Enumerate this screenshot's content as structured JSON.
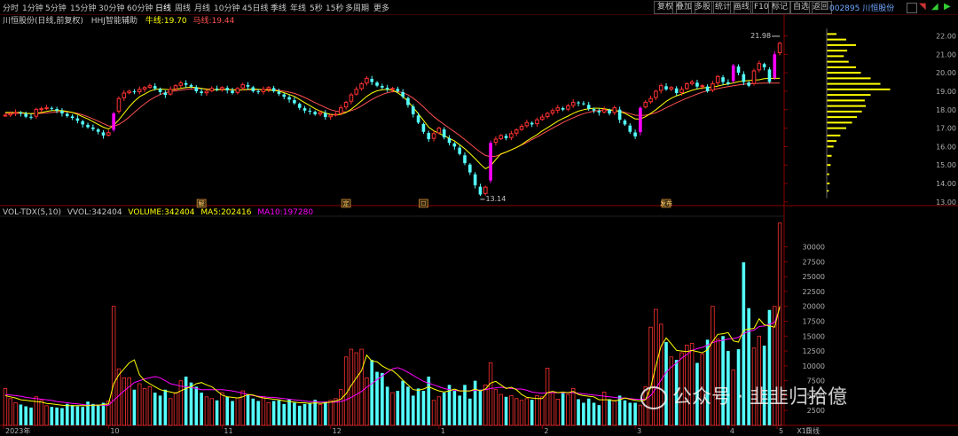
{
  "toolbar": {
    "items": [
      "分时",
      "1分钟",
      "5分钟",
      "15分钟",
      "30分钟",
      "60分钟",
      "日线",
      "周线",
      "月线",
      "10分钟",
      "45日线",
      "季线",
      "年线",
      "5秒",
      "15秒",
      "多周期",
      "更多"
    ],
    "active_index": 6,
    "right_items": [
      "复权",
      "叠加",
      "多股",
      "统计",
      "画线",
      "F10",
      "标记",
      "自选",
      "返回"
    ],
    "stock_name": "002895 川恒股份"
  },
  "kline_panel": {
    "stock_label": "川恒股份(日线,前复权)",
    "indicator_name": "HHJ智能辅助",
    "ma1_label": "牛线:",
    "ma1_value": "19.70",
    "ma2_label": "马线:",
    "ma2_value": "19.44",
    "high_annotation": "21.98",
    "low_annotation": "13.14",
    "marker_labels": [
      "解",
      "定",
      "☐",
      "发布"
    ],
    "y_ticks": [
      "22.00",
      "21.00",
      "20.00",
      "19.00",
      "18.00",
      "17.00",
      "16.00",
      "15.00",
      "14.00",
      "13.00"
    ]
  },
  "volume_panel": {
    "label": "VOL-TDX(5,10)",
    "vvol_label": "VVOL:",
    "vvol_value": "342404",
    "volume_label": "VOLUME:",
    "volume_value": "342404",
    "ma5_label": "MA5:",
    "ma5_value": "202416",
    "ma10_label": "MA10:",
    "ma10_value": "197280",
    "y_ticks": [
      "30000",
      "27500",
      "25000",
      "22500",
      "20000",
      "17500",
      "15000",
      "12500",
      "10000",
      "7500",
      "5000",
      "2500"
    ],
    "unit": "X10"
  },
  "x_axis": {
    "labels": [
      "2023年",
      "10",
      "11",
      "12",
      "1",
      "2",
      "3",
      "4",
      "5"
    ],
    "period_label": "日线"
  },
  "watermark": "公众号 · 韭韭归拾億",
  "colors": {
    "up": "#ff3232",
    "down": "#54ffff",
    "highlight": "#ff00ff",
    "ma_yellow": "#ffff00",
    "ma_magenta": "#ff00ff",
    "ma_red": "#ff5050",
    "axis": "#8b0000",
    "profile": "#ffff00"
  },
  "chart_data": [
    {
      "type": "candlestick",
      "title": "川恒股份(日线,前复权)",
      "y_range": [
        12.8,
        22.6
      ],
      "candles_close": [
        17.7,
        17.78,
        17.85,
        17.8,
        17.62,
        17.58,
        18.02,
        18.05,
        18.1,
        18.05,
        17.95,
        17.8,
        17.65,
        17.55,
        17.4,
        17.2,
        17.05,
        16.95,
        16.8,
        16.6,
        16.75,
        17.8,
        18.6,
        18.9,
        19.0,
        18.95,
        19.1,
        19.2,
        19.3,
        19.15,
        18.95,
        18.8,
        19.1,
        19.3,
        19.45,
        19.35,
        19.25,
        19.0,
        18.9,
        19.0,
        19.15,
        19.1,
        19.2,
        19.05,
        18.9,
        19.15,
        19.35,
        19.25,
        19.0,
        18.95,
        19.1,
        19.2,
        19.0,
        18.85,
        18.7,
        18.55,
        18.35,
        18.1,
        17.95,
        17.9,
        17.75,
        17.85,
        17.6,
        17.7,
        17.75,
        18.1,
        18.4,
        18.8,
        19.1,
        19.4,
        19.7,
        19.5,
        19.3,
        19.2,
        19.1,
        19.15,
        19.0,
        18.7,
        18.25,
        17.75,
        17.3,
        16.8,
        16.4,
        16.7,
        17.0,
        16.5,
        16.2,
        16.0,
        15.6,
        15.1,
        14.6,
        13.9,
        13.4,
        13.8,
        16.2,
        16.4,
        16.6,
        16.45,
        16.7,
        16.9,
        17.1,
        17.3,
        17.2,
        17.45,
        17.6,
        17.8,
        17.95,
        18.1,
        18.0,
        18.2,
        18.4,
        18.35,
        18.3,
        18.05,
        17.95,
        17.85,
        18.0,
        17.8,
        18.1,
        17.45,
        17.2,
        16.8,
        16.55,
        18.1,
        18.4,
        18.6,
        19.0,
        19.3,
        19.1,
        19.2,
        18.9,
        19.1,
        19.4,
        19.5,
        19.25,
        19.3,
        19.0,
        19.4,
        19.8,
        19.5,
        19.4,
        20.4,
        20.0,
        19.5,
        19.3,
        20.1,
        20.5,
        20.3,
        19.5,
        21.0,
        21.6
      ],
      "ma_yellow": [
        17.85,
        17.85,
        17.85,
        17.85,
        17.8,
        17.78,
        17.8,
        17.85,
        17.9,
        17.95,
        17.95,
        17.95,
        17.9,
        17.85,
        17.75,
        17.62,
        17.5,
        17.35,
        17.2,
        17.05,
        16.95,
        17.15,
        17.45,
        17.8,
        18.15,
        18.45,
        18.7,
        18.85,
        19.0,
        19.1,
        19.12,
        19.1,
        19.08,
        19.1,
        19.15,
        19.2,
        19.22,
        19.2,
        19.15,
        19.1,
        19.08,
        19.08,
        19.1,
        19.1,
        19.08,
        19.05,
        19.08,
        19.1,
        19.12,
        19.1,
        19.08,
        19.05,
        19.05,
        19.0,
        18.92,
        18.82,
        18.72,
        18.55,
        18.38,
        18.22,
        18.05,
        17.92,
        17.82,
        17.75,
        17.72,
        17.75,
        17.85,
        18.02,
        18.25,
        18.48,
        18.72,
        18.9,
        19.02,
        19.08,
        19.1,
        19.05,
        18.92,
        18.72,
        18.45,
        18.12,
        17.78,
        17.42,
        17.05,
        16.85,
        16.72,
        16.58,
        16.45,
        16.3,
        16.1,
        15.88,
        15.62,
        15.35,
        15.05,
        14.8,
        14.95,
        15.3,
        15.6,
        15.7,
        15.82,
        15.95,
        16.1,
        16.3,
        16.48,
        16.65,
        16.85,
        17.02,
        17.2,
        17.38,
        17.52,
        17.65,
        17.8,
        17.92,
        18.0,
        18.05,
        18.08,
        18.08,
        18.05,
        18.0,
        17.95,
        17.9,
        17.8,
        17.65,
        17.5,
        17.5,
        17.62,
        17.8,
        18.0,
        18.22,
        18.45,
        18.62,
        18.75,
        18.85,
        18.95,
        19.05,
        19.12,
        19.18,
        19.2,
        19.22,
        19.28,
        19.35,
        19.4,
        19.45,
        19.52,
        19.55,
        19.58,
        19.6,
        19.62,
        19.68,
        19.7,
        19.7,
        19.7
      ],
      "ma_red": [
        17.8,
        17.8,
        17.8,
        17.8,
        17.8,
        17.78,
        17.78,
        17.8,
        17.82,
        17.85,
        17.88,
        17.9,
        17.88,
        17.85,
        17.8,
        17.72,
        17.62,
        17.5,
        17.38,
        17.25,
        17.12,
        17.1,
        17.2,
        17.38,
        17.6,
        17.85,
        18.1,
        18.32,
        18.52,
        18.68,
        18.82,
        18.92,
        18.98,
        19.02,
        19.06,
        19.1,
        19.12,
        19.14,
        19.14,
        19.12,
        19.1,
        19.08,
        19.08,
        19.08,
        19.08,
        19.07,
        19.07,
        19.08,
        19.08,
        19.08,
        19.08,
        19.08,
        19.07,
        19.05,
        19.0,
        18.95,
        18.88,
        18.78,
        18.66,
        18.52,
        18.38,
        18.25,
        18.12,
        18.0,
        17.92,
        17.88,
        17.88,
        17.95,
        18.05,
        18.2,
        18.38,
        18.55,
        18.7,
        18.82,
        18.92,
        18.98,
        18.98,
        18.92,
        18.8,
        18.62,
        18.4,
        18.15,
        17.88,
        17.62,
        17.4,
        17.2,
        17.0,
        16.8,
        16.6,
        16.38,
        16.15,
        15.92,
        15.7,
        15.52,
        15.45,
        15.48,
        15.58,
        15.7,
        15.82,
        15.95,
        16.08,
        16.22,
        16.38,
        16.52,
        16.68,
        16.84,
        17.0,
        17.15,
        17.3,
        17.44,
        17.56,
        17.68,
        17.78,
        17.86,
        17.92,
        17.95,
        17.97,
        17.97,
        17.96,
        17.92,
        17.86,
        17.78,
        17.7,
        17.68,
        17.7,
        17.76,
        17.84,
        17.96,
        18.1,
        18.24,
        18.38,
        18.5,
        18.62,
        18.74,
        18.85,
        18.95,
        19.02,
        19.08,
        19.14,
        19.2,
        19.25,
        19.3,
        19.34,
        19.38,
        19.4,
        19.42,
        19.43,
        19.44,
        19.44,
        19.44,
        19.44
      ]
    },
    {
      "type": "bar",
      "title": "VOL-TDX(5,10)",
      "unit": "X10",
      "y_range": [
        0,
        35000
      ],
      "volumes": [
        6200,
        4500,
        3800,
        3500,
        3200,
        3000,
        4800,
        4200,
        3300,
        3100,
        3000,
        2900,
        3600,
        3400,
        3200,
        3100,
        4000,
        3600,
        3500,
        3800,
        4100,
        20000,
        9500,
        8000,
        8000,
        6000,
        7000,
        6200,
        6500,
        5500,
        5000,
        6000,
        4500,
        5500,
        7500,
        8200,
        7200,
        6500,
        5500,
        4800,
        4500,
        4200,
        5500,
        4800,
        4100,
        4600,
        5800,
        5200,
        4500,
        4100,
        4800,
        3800,
        4100,
        4200,
        3600,
        4400,
        3800,
        3300,
        3600,
        3800,
        4300,
        3500,
        4000,
        4200,
        4500,
        6000,
        11500,
        12800,
        12200,
        12800,
        8000,
        11000,
        9000,
        8800,
        6500,
        5500,
        5800,
        7500,
        6500,
        5000,
        6200,
        5800,
        8200,
        4200,
        4800,
        5500,
        6800,
        5800,
        5000,
        6800,
        4500,
        7500,
        6000,
        6800,
        10500,
        6000,
        5200,
        4800,
        5000,
        4500,
        4200,
        4500,
        4300,
        5000,
        4800,
        9600,
        5500,
        4400,
        5400,
        5200,
        6200,
        4400,
        3800,
        4500,
        3800,
        3400,
        5600,
        4400,
        4200,
        5000,
        4200,
        3800,
        3800,
        3400,
        6500,
        16500,
        19500,
        17000,
        14000,
        11500,
        11000,
        12200,
        13500,
        13800,
        10500,
        12000,
        14400,
        20000,
        14500,
        15000,
        12500,
        9300,
        12800,
        27400,
        19700,
        13000,
        15000,
        13400,
        19400,
        20000,
        34000
      ],
      "volume_colors": "close-vs-open",
      "ma5": [
        5000,
        4800,
        4600,
        4300,
        4200,
        4100,
        4000,
        3900,
        3700,
        3600,
        3500,
        3400,
        3300,
        3300,
        3300,
        3300,
        3300,
        3400,
        3400,
        3500,
        3600,
        7000,
        8500,
        9500,
        10500,
        11000,
        8500,
        7500,
        7000,
        6500,
        6000,
        5800,
        5600,
        5400,
        5800,
        6200,
        6500,
        7000,
        7200,
        6800,
        6500,
        5800,
        5100,
        4800,
        4700,
        4600,
        4800,
        5200,
        5100,
        4800,
        4600,
        4500,
        4400,
        4300,
        4100,
        4000,
        3900,
        3800,
        3800,
        3700,
        3800,
        3700,
        3800,
        3900,
        4100,
        4400,
        5300,
        6700,
        8000,
        9200,
        11800,
        10800,
        10700,
        10000,
        9500,
        9200,
        8500,
        7600,
        6800,
        6000,
        5900,
        6100,
        6500,
        6100,
        5800,
        5600,
        5800,
        6100,
        5800,
        5800,
        5800,
        6100,
        5800,
        6100,
        7100,
        7400,
        6800,
        6200,
        6400,
        6000,
        5200,
        4700,
        4600,
        4500,
        4500,
        5500,
        5700,
        5500,
        5600,
        5500,
        5700,
        5200,
        5000,
        4900,
        4800,
        4300,
        4300,
        4300,
        4100,
        4300,
        4600,
        4400,
        4200,
        4100,
        4300,
        6400,
        10000,
        13300,
        14700,
        13700,
        12600,
        12500,
        12400,
        12600,
        12400,
        12200,
        12700,
        14100,
        15300,
        15400,
        15600,
        14200,
        14000,
        16000,
        16200,
        16300,
        17900,
        16900,
        16700,
        16500,
        20000
      ],
      "ma10": [
        5200,
        5100,
        5000,
        4900,
        4700,
        4600,
        4500,
        4400,
        4300,
        4200,
        4000,
        3900,
        3800,
        3700,
        3600,
        3500,
        3400,
        3400,
        3400,
        3400,
        3400,
        4200,
        5000,
        5800,
        6500,
        7200,
        7500,
        7800,
        8000,
        8200,
        8000,
        7500,
        7000,
        6800,
        6600,
        6500,
        6400,
        6200,
        6000,
        6000,
        6000,
        6000,
        6000,
        5900,
        5800,
        5600,
        5400,
        5200,
        5000,
        4900,
        4800,
        4700,
        4700,
        4600,
        4500,
        4400,
        4300,
        4200,
        4100,
        4000,
        4000,
        3900,
        3900,
        3900,
        3900,
        4000,
        4300,
        4700,
        5200,
        5700,
        6400,
        7000,
        7700,
        8300,
        8900,
        9500,
        9700,
        9400,
        8900,
        8400,
        7900,
        7400,
        7100,
        6800,
        6500,
        6200,
        6000,
        5900,
        5800,
        5800,
        5800,
        5900,
        5900,
        6000,
        6200,
        6300,
        6400,
        6300,
        6200,
        6100,
        6100,
        5900,
        5600,
        5500,
        5400,
        5500,
        5500,
        5500,
        5500,
        5500,
        5500,
        5400,
        5300,
        5200,
        5100,
        5000,
        4900,
        4800,
        4700,
        4600,
        4600,
        4500,
        4400,
        4400,
        4400,
        5000,
        6200,
        7600,
        8900,
        9800,
        10500,
        11300,
        11900,
        12600,
        12900,
        13100,
        13500,
        13900,
        14200,
        14300,
        14500,
        14600,
        14800,
        15400,
        15800,
        16000,
        16600,
        16700,
        17000,
        17300,
        19700
      ]
    }
  ]
}
